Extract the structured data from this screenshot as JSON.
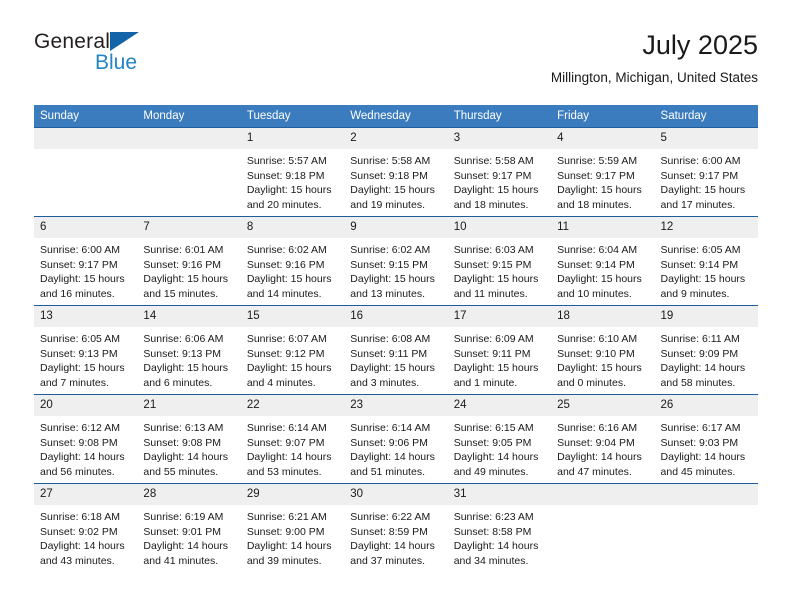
{
  "brand": {
    "name_part1": "General",
    "name_part2": "Blue",
    "triangle_color": "#1263a8",
    "blue_text_color": "#2384c6"
  },
  "header": {
    "title": "July 2025",
    "subtitle": "Millington, Michigan, United States"
  },
  "theme": {
    "header_row_bg": "#3b7cbe",
    "row_divider": "#1f5c9e",
    "daynum_bg": "#efefef",
    "text": "#1a1a1a"
  },
  "calendar": {
    "weekday_headers": [
      "Sunday",
      "Monday",
      "Tuesday",
      "Wednesday",
      "Thursday",
      "Friday",
      "Saturday"
    ],
    "weeks": [
      [
        {
          "day": "",
          "sunrise": "",
          "sunset": "",
          "daylight_line1": "",
          "daylight_line2": ""
        },
        {
          "day": "",
          "sunrise": "",
          "sunset": "",
          "daylight_line1": "",
          "daylight_line2": ""
        },
        {
          "day": "1",
          "sunrise": "Sunrise: 5:57 AM",
          "sunset": "Sunset: 9:18 PM",
          "daylight_line1": "Daylight: 15 hours",
          "daylight_line2": "and 20 minutes."
        },
        {
          "day": "2",
          "sunrise": "Sunrise: 5:58 AM",
          "sunset": "Sunset: 9:18 PM",
          "daylight_line1": "Daylight: 15 hours",
          "daylight_line2": "and 19 minutes."
        },
        {
          "day": "3",
          "sunrise": "Sunrise: 5:58 AM",
          "sunset": "Sunset: 9:17 PM",
          "daylight_line1": "Daylight: 15 hours",
          "daylight_line2": "and 18 minutes."
        },
        {
          "day": "4",
          "sunrise": "Sunrise: 5:59 AM",
          "sunset": "Sunset: 9:17 PM",
          "daylight_line1": "Daylight: 15 hours",
          "daylight_line2": "and 18 minutes."
        },
        {
          "day": "5",
          "sunrise": "Sunrise: 6:00 AM",
          "sunset": "Sunset: 9:17 PM",
          "daylight_line1": "Daylight: 15 hours",
          "daylight_line2": "and 17 minutes."
        }
      ],
      [
        {
          "day": "6",
          "sunrise": "Sunrise: 6:00 AM",
          "sunset": "Sunset: 9:17 PM",
          "daylight_line1": "Daylight: 15 hours",
          "daylight_line2": "and 16 minutes."
        },
        {
          "day": "7",
          "sunrise": "Sunrise: 6:01 AM",
          "sunset": "Sunset: 9:16 PM",
          "daylight_line1": "Daylight: 15 hours",
          "daylight_line2": "and 15 minutes."
        },
        {
          "day": "8",
          "sunrise": "Sunrise: 6:02 AM",
          "sunset": "Sunset: 9:16 PM",
          "daylight_line1": "Daylight: 15 hours",
          "daylight_line2": "and 14 minutes."
        },
        {
          "day": "9",
          "sunrise": "Sunrise: 6:02 AM",
          "sunset": "Sunset: 9:15 PM",
          "daylight_line1": "Daylight: 15 hours",
          "daylight_line2": "and 13 minutes."
        },
        {
          "day": "10",
          "sunrise": "Sunrise: 6:03 AM",
          "sunset": "Sunset: 9:15 PM",
          "daylight_line1": "Daylight: 15 hours",
          "daylight_line2": "and 11 minutes."
        },
        {
          "day": "11",
          "sunrise": "Sunrise: 6:04 AM",
          "sunset": "Sunset: 9:14 PM",
          "daylight_line1": "Daylight: 15 hours",
          "daylight_line2": "and 10 minutes."
        },
        {
          "day": "12",
          "sunrise": "Sunrise: 6:05 AM",
          "sunset": "Sunset: 9:14 PM",
          "daylight_line1": "Daylight: 15 hours",
          "daylight_line2": "and 9 minutes."
        }
      ],
      [
        {
          "day": "13",
          "sunrise": "Sunrise: 6:05 AM",
          "sunset": "Sunset: 9:13 PM",
          "daylight_line1": "Daylight: 15 hours",
          "daylight_line2": "and 7 minutes."
        },
        {
          "day": "14",
          "sunrise": "Sunrise: 6:06 AM",
          "sunset": "Sunset: 9:13 PM",
          "daylight_line1": "Daylight: 15 hours",
          "daylight_line2": "and 6 minutes."
        },
        {
          "day": "15",
          "sunrise": "Sunrise: 6:07 AM",
          "sunset": "Sunset: 9:12 PM",
          "daylight_line1": "Daylight: 15 hours",
          "daylight_line2": "and 4 minutes."
        },
        {
          "day": "16",
          "sunrise": "Sunrise: 6:08 AM",
          "sunset": "Sunset: 9:11 PM",
          "daylight_line1": "Daylight: 15 hours",
          "daylight_line2": "and 3 minutes."
        },
        {
          "day": "17",
          "sunrise": "Sunrise: 6:09 AM",
          "sunset": "Sunset: 9:11 PM",
          "daylight_line1": "Daylight: 15 hours",
          "daylight_line2": "and 1 minute."
        },
        {
          "day": "18",
          "sunrise": "Sunrise: 6:10 AM",
          "sunset": "Sunset: 9:10 PM",
          "daylight_line1": "Daylight: 15 hours",
          "daylight_line2": "and 0 minutes."
        },
        {
          "day": "19",
          "sunrise": "Sunrise: 6:11 AM",
          "sunset": "Sunset: 9:09 PM",
          "daylight_line1": "Daylight: 14 hours",
          "daylight_line2": "and 58 minutes."
        }
      ],
      [
        {
          "day": "20",
          "sunrise": "Sunrise: 6:12 AM",
          "sunset": "Sunset: 9:08 PM",
          "daylight_line1": "Daylight: 14 hours",
          "daylight_line2": "and 56 minutes."
        },
        {
          "day": "21",
          "sunrise": "Sunrise: 6:13 AM",
          "sunset": "Sunset: 9:08 PM",
          "daylight_line1": "Daylight: 14 hours",
          "daylight_line2": "and 55 minutes."
        },
        {
          "day": "22",
          "sunrise": "Sunrise: 6:14 AM",
          "sunset": "Sunset: 9:07 PM",
          "daylight_line1": "Daylight: 14 hours",
          "daylight_line2": "and 53 minutes."
        },
        {
          "day": "23",
          "sunrise": "Sunrise: 6:14 AM",
          "sunset": "Sunset: 9:06 PM",
          "daylight_line1": "Daylight: 14 hours",
          "daylight_line2": "and 51 minutes."
        },
        {
          "day": "24",
          "sunrise": "Sunrise: 6:15 AM",
          "sunset": "Sunset: 9:05 PM",
          "daylight_line1": "Daylight: 14 hours",
          "daylight_line2": "and 49 minutes."
        },
        {
          "day": "25",
          "sunrise": "Sunrise: 6:16 AM",
          "sunset": "Sunset: 9:04 PM",
          "daylight_line1": "Daylight: 14 hours",
          "daylight_line2": "and 47 minutes."
        },
        {
          "day": "26",
          "sunrise": "Sunrise: 6:17 AM",
          "sunset": "Sunset: 9:03 PM",
          "daylight_line1": "Daylight: 14 hours",
          "daylight_line2": "and 45 minutes."
        }
      ],
      [
        {
          "day": "27",
          "sunrise": "Sunrise: 6:18 AM",
          "sunset": "Sunset: 9:02 PM",
          "daylight_line1": "Daylight: 14 hours",
          "daylight_line2": "and 43 minutes."
        },
        {
          "day": "28",
          "sunrise": "Sunrise: 6:19 AM",
          "sunset": "Sunset: 9:01 PM",
          "daylight_line1": "Daylight: 14 hours",
          "daylight_line2": "and 41 minutes."
        },
        {
          "day": "29",
          "sunrise": "Sunrise: 6:21 AM",
          "sunset": "Sunset: 9:00 PM",
          "daylight_line1": "Daylight: 14 hours",
          "daylight_line2": "and 39 minutes."
        },
        {
          "day": "30",
          "sunrise": "Sunrise: 6:22 AM",
          "sunset": "Sunset: 8:59 PM",
          "daylight_line1": "Daylight: 14 hours",
          "daylight_line2": "and 37 minutes."
        },
        {
          "day": "31",
          "sunrise": "Sunrise: 6:23 AM",
          "sunset": "Sunset: 8:58 PM",
          "daylight_line1": "Daylight: 14 hours",
          "daylight_line2": "and 34 minutes."
        },
        {
          "day": "",
          "sunrise": "",
          "sunset": "",
          "daylight_line1": "",
          "daylight_line2": ""
        },
        {
          "day": "",
          "sunrise": "",
          "sunset": "",
          "daylight_line1": "",
          "daylight_line2": ""
        }
      ]
    ]
  }
}
